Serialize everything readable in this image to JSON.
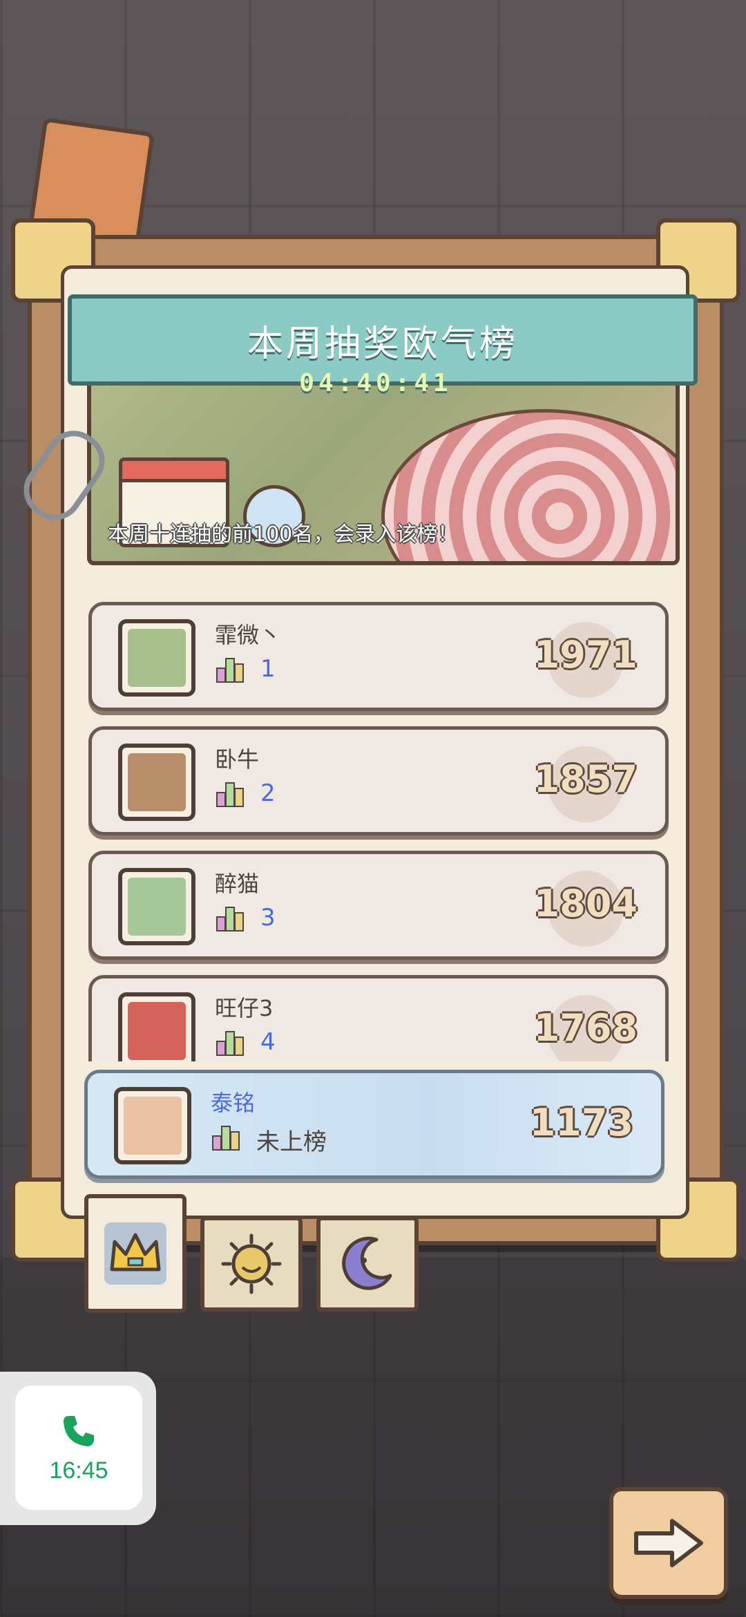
{
  "leaderboard": {
    "title": "本周抽奖欧气榜",
    "timer": "04:40:41",
    "note": "本周十连抽的前100名，会录入该榜！",
    "entries": [
      {
        "name": "霏微丶",
        "rank": "1",
        "score": "1971"
      },
      {
        "name": "卧牛",
        "rank": "2",
        "score": "1857"
      },
      {
        "name": "醉猫",
        "rank": "3",
        "score": "1804"
      },
      {
        "name": "旺仔3",
        "rank": "4",
        "score": "1768"
      }
    ],
    "me": {
      "name": "泰铭",
      "rank": "未上榜",
      "score": "1173"
    }
  },
  "tabs": [
    {
      "icon": "crown-icon",
      "active": true
    },
    {
      "icon": "sun-icon",
      "active": false
    },
    {
      "icon": "moon-icon",
      "active": false
    }
  ],
  "call_overlay": {
    "icon": "phone-icon",
    "time": "16:45"
  },
  "colors": {
    "rank_blue": "#4a6ad6",
    "call_green": "#1aa35c",
    "title_teal": "#8ccac6"
  }
}
